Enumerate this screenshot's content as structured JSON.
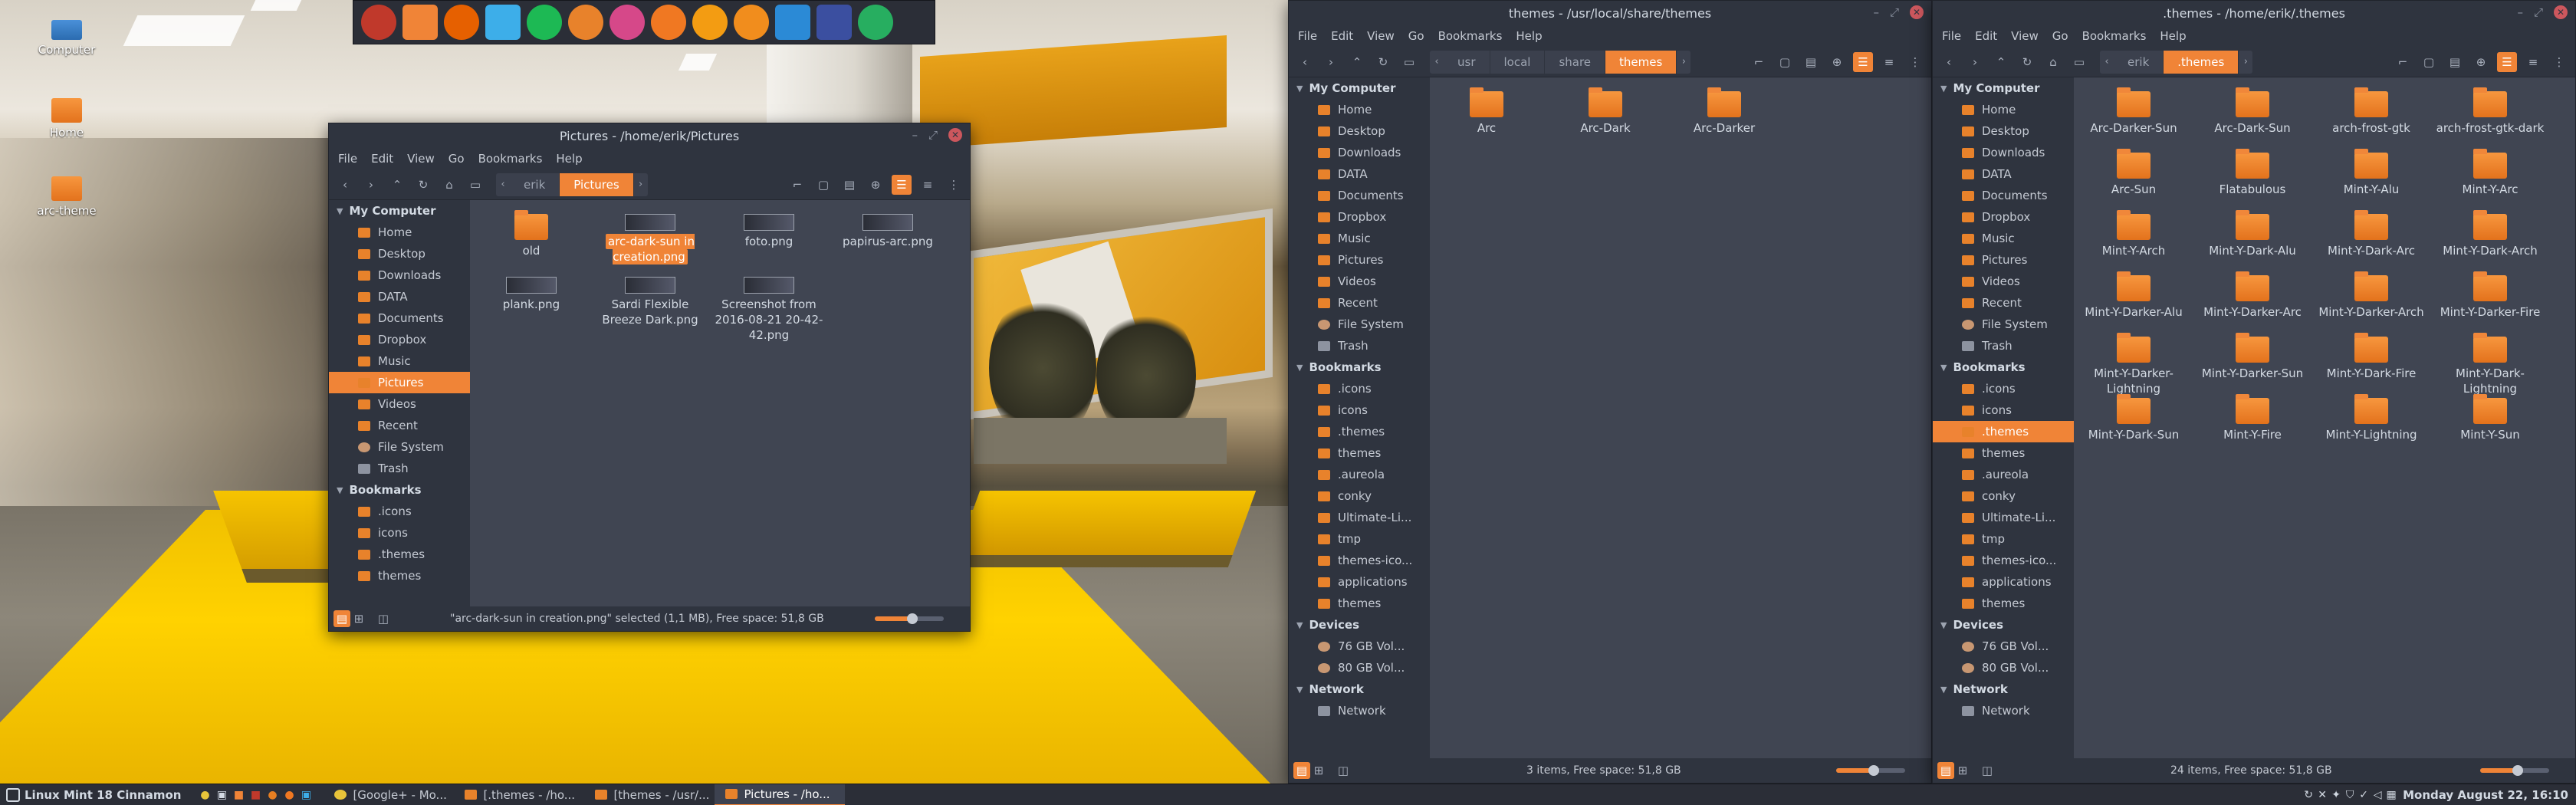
{
  "desktop": {
    "icons": [
      {
        "label": "Computer"
      },
      {
        "label": "Home"
      },
      {
        "label": "arc-theme"
      }
    ]
  },
  "dock": {
    "apps": [
      {
        "name": "bow-icon",
        "color": "#c0392b"
      },
      {
        "name": "folder-icon",
        "color": "#f08437"
      },
      {
        "name": "firefox-icon",
        "color": "#e66000"
      },
      {
        "name": "files-icon",
        "color": "#3daee9"
      },
      {
        "name": "spotify-icon",
        "color": "#1db954"
      },
      {
        "name": "cup-icon",
        "color": "#e8822b"
      },
      {
        "name": "app-icon",
        "color": "#d64889"
      },
      {
        "name": "s-app-icon",
        "color": "#f07822"
      },
      {
        "name": "orange-icon",
        "color": "#f39c12"
      },
      {
        "name": "vlc-icon",
        "color": "#f18d1d"
      },
      {
        "name": "brackets-icon",
        "color": "#2b8ad6"
      },
      {
        "name": "monitor-icon",
        "color": "#3b4fa0"
      },
      {
        "name": "pulse-icon",
        "color": "#27ae60"
      }
    ]
  },
  "win_pictures": {
    "title": "Pictures - /home/erik/Pictures",
    "menu": [
      "File",
      "Edit",
      "View",
      "Go",
      "Bookmarks",
      "Help"
    ],
    "crumbs": [
      "erik",
      "Pictures"
    ],
    "sidebar": {
      "my_computer": "My Computer",
      "items": [
        "Home",
        "Desktop",
        "Downloads",
        "DATA",
        "Documents",
        "Dropbox",
        "Music",
        "Pictures",
        "Videos",
        "Recent",
        "File System",
        "Trash"
      ],
      "bookmarks": "Bookmarks",
      "bm_items": [
        ".icons",
        "icons",
        ".themes",
        "themes"
      ]
    },
    "files": [
      {
        "label": "old",
        "kind": "folder"
      },
      {
        "label": "arc-dark-sun in creation.png",
        "kind": "image"
      },
      {
        "label": "foto.png",
        "kind": "image"
      },
      {
        "label": "papirus-arc.png",
        "kind": "image"
      },
      {
        "label": "plank.png",
        "kind": "image"
      },
      {
        "label": "Sardi Flexible Breeze Dark.png",
        "kind": "image"
      },
      {
        "label": "Screenshot from 2016-08-21 20-42-42.png",
        "kind": "image"
      }
    ],
    "status": "\"arc-dark-sun in creation.png\" selected (1,1 MB), Free space: 51,8 GB"
  },
  "win_themes": {
    "title": "themes - /usr/local/share/themes",
    "menu": [
      "File",
      "Edit",
      "View",
      "Go",
      "Bookmarks",
      "Help"
    ],
    "crumbs": [
      "usr",
      "local",
      "share",
      "themes"
    ],
    "sidebar": {
      "my_computer": "My Computer",
      "items": [
        "Home",
        "Desktop",
        "Downloads",
        "DATA",
        "Documents",
        "Dropbox",
        "Music",
        "Pictures",
        "Videos",
        "Recent",
        "File System",
        "Trash"
      ],
      "bookmarks": "Bookmarks",
      "bm_items": [
        ".icons",
        "icons",
        ".themes",
        "themes",
        ".aureola",
        "conky",
        "Ultimate-Li...",
        "tmp",
        "themes-ico...",
        "applications",
        "themes"
      ],
      "devices": "Devices",
      "dev_items": [
        "76 GB Vol...",
        "80 GB Vol..."
      ],
      "network": "Network",
      "net_items": [
        "Network"
      ]
    },
    "files": [
      {
        "label": "Arc"
      },
      {
        "label": "Arc-Dark"
      },
      {
        "label": "Arc-Darker"
      }
    ],
    "status": "3 items, Free space: 51,8 GB"
  },
  "win_dotthemes": {
    "title": ".themes - /home/erik/.themes",
    "menu": [
      "File",
      "Edit",
      "View",
      "Go",
      "Bookmarks",
      "Help"
    ],
    "crumbs": [
      "erik",
      ".themes"
    ],
    "sidebar": {
      "my_computer": "My Computer",
      "items": [
        "Home",
        "Desktop",
        "Downloads",
        "DATA",
        "Documents",
        "Dropbox",
        "Music",
        "Pictures",
        "Videos",
        "Recent",
        "File System",
        "Trash"
      ],
      "bookmarks": "Bookmarks",
      "bm_items": [
        ".icons",
        "icons",
        ".themes",
        "themes",
        ".aureola",
        "conky",
        "Ultimate-Li...",
        "tmp",
        "themes-ico...",
        "applications",
        "themes"
      ],
      "devices": "Devices",
      "dev_items": [
        "76 GB Vol...",
        "80 GB Vol..."
      ],
      "network": "Network",
      "net_items": [
        "Network"
      ]
    },
    "files": [
      {
        "label": "Arc-Darker-Sun"
      },
      {
        "label": "Arc-Dark-Sun"
      },
      {
        "label": "arch-frost-gtk"
      },
      {
        "label": "arch-frost-gtk-dark"
      },
      {
        "label": "Arc-Sun"
      },
      {
        "label": "Flatabulous"
      },
      {
        "label": "Mint-Y-Alu"
      },
      {
        "label": "Mint-Y-Arc"
      },
      {
        "label": "Mint-Y-Arch"
      },
      {
        "label": "Mint-Y-Dark-Alu"
      },
      {
        "label": "Mint-Y-Dark-Arc"
      },
      {
        "label": "Mint-Y-Dark-Arch"
      },
      {
        "label": "Mint-Y-Darker-Alu"
      },
      {
        "label": "Mint-Y-Darker-Arc"
      },
      {
        "label": "Mint-Y-Darker-Arch"
      },
      {
        "label": "Mint-Y-Darker-Fire"
      },
      {
        "label": "Mint-Y-Darker-Lightning"
      },
      {
        "label": "Mint-Y-Darker-Sun"
      },
      {
        "label": "Mint-Y-Dark-Fire"
      },
      {
        "label": "Mint-Y-Dark-Lightning"
      },
      {
        "label": "Mint-Y-Dark-Sun"
      },
      {
        "label": "Mint-Y-Fire"
      },
      {
        "label": "Mint-Y-Lightning"
      },
      {
        "label": "Mint-Y-Sun"
      }
    ],
    "status": "24 items, Free space: 51,8 GB"
  },
  "panel": {
    "menu_label": "Linux Mint 18 Cinnamon",
    "tasks": [
      "[Google+ - Mo...",
      "[.themes - /ho...",
      "[themes - /usr/...",
      "Pictures - /ho..."
    ],
    "clock": "Monday August 22, 16:10"
  },
  "colors": {
    "accent": "#f08437",
    "bg": "#383c4a",
    "panel": "#2b2e37"
  }
}
